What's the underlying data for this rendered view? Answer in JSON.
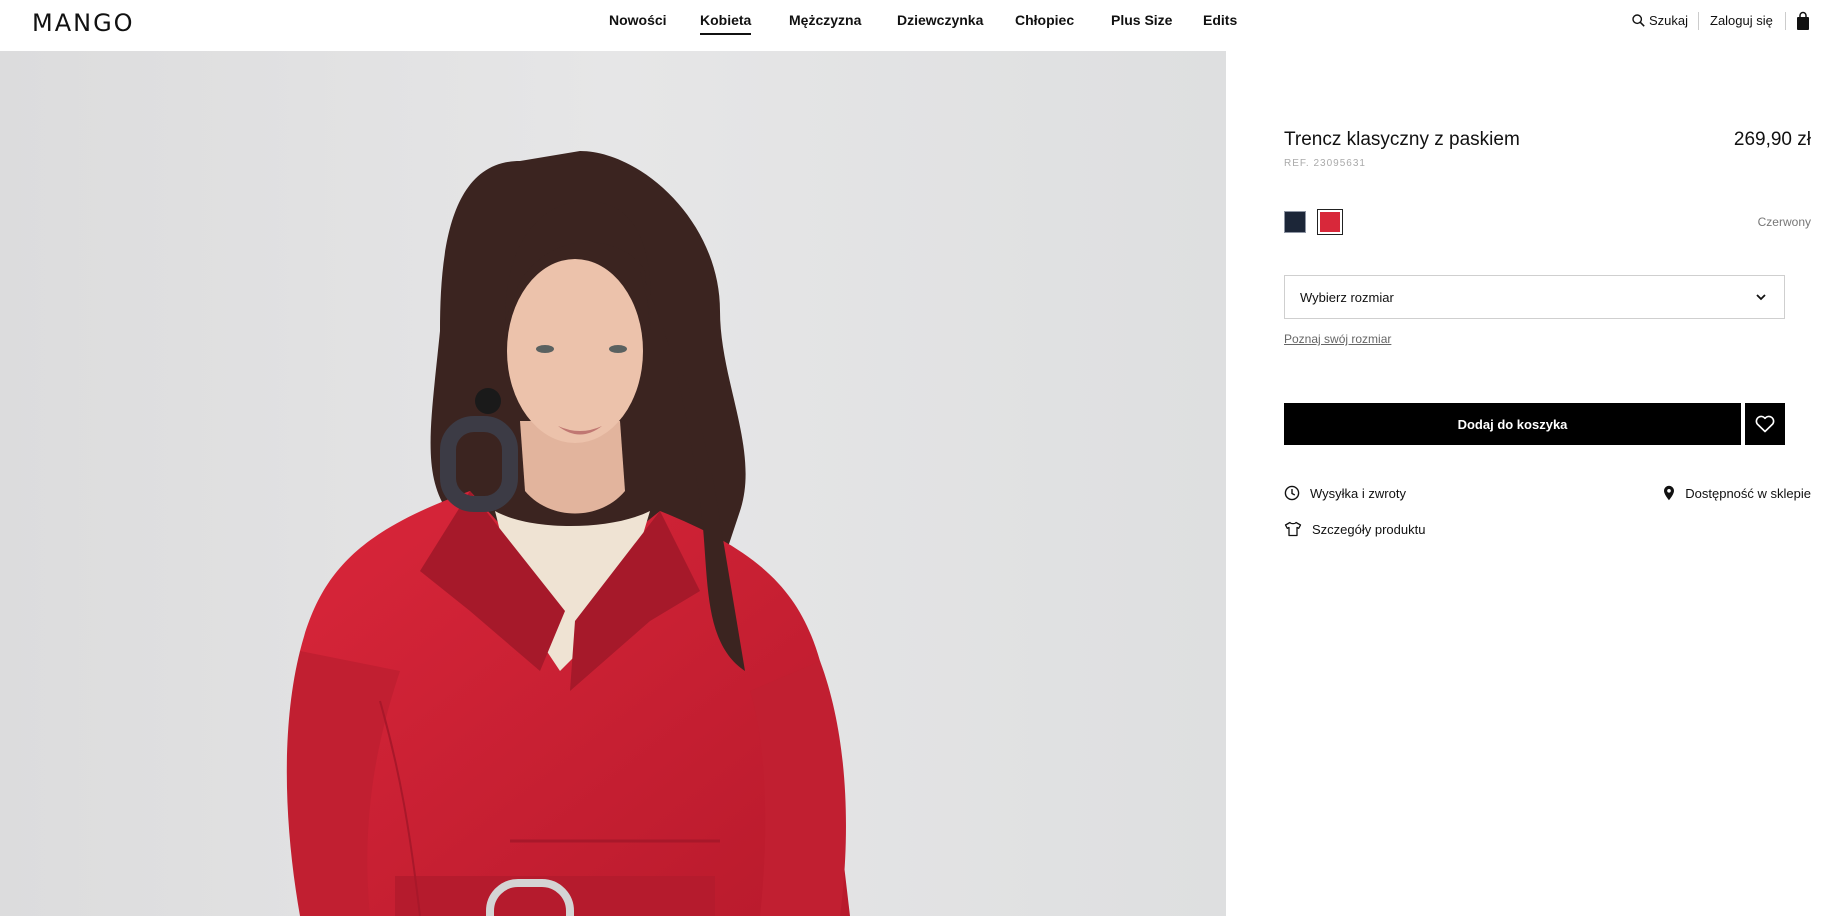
{
  "header": {
    "logo": "MANGO",
    "nav": [
      {
        "label": "Nowości",
        "active": false
      },
      {
        "label": "Kobieta",
        "active": true
      },
      {
        "label": "Mężczyzna",
        "active": false
      },
      {
        "label": "Dziewczynka",
        "active": false
      },
      {
        "label": "Chłopiec",
        "active": false
      },
      {
        "label": "Plus Size",
        "active": false
      },
      {
        "label": "Edits",
        "active": false
      }
    ],
    "search_label": "Szukaj",
    "login_label": "Zaloguj się",
    "bag_icon": "shopping-bag-icon"
  },
  "product": {
    "title": "Trencz klasyczny z paskiem",
    "price": "269,90 zł",
    "ref": "REF. 23095631",
    "colors": [
      {
        "name": "navy",
        "hex": "#1c2638",
        "selected": false
      },
      {
        "name": "Czerwony",
        "hex": "#d8283a",
        "selected": true
      }
    ],
    "selected_color_name": "Czerwony",
    "size_select_placeholder": "Wybierz rozmiar",
    "size_guide_link": "Poznaj swój rozmiar",
    "add_to_cart_label": "Dodaj do koszyka",
    "info_links": {
      "shipping": "Wysyłka i zwroty",
      "store_availability": "Dostępność w sklepie",
      "details": "Szczegóły produktu"
    }
  },
  "colors": {
    "brand_black": "#000000",
    "image_background": "#e3e3e4",
    "coat_red": "#d8283a"
  }
}
